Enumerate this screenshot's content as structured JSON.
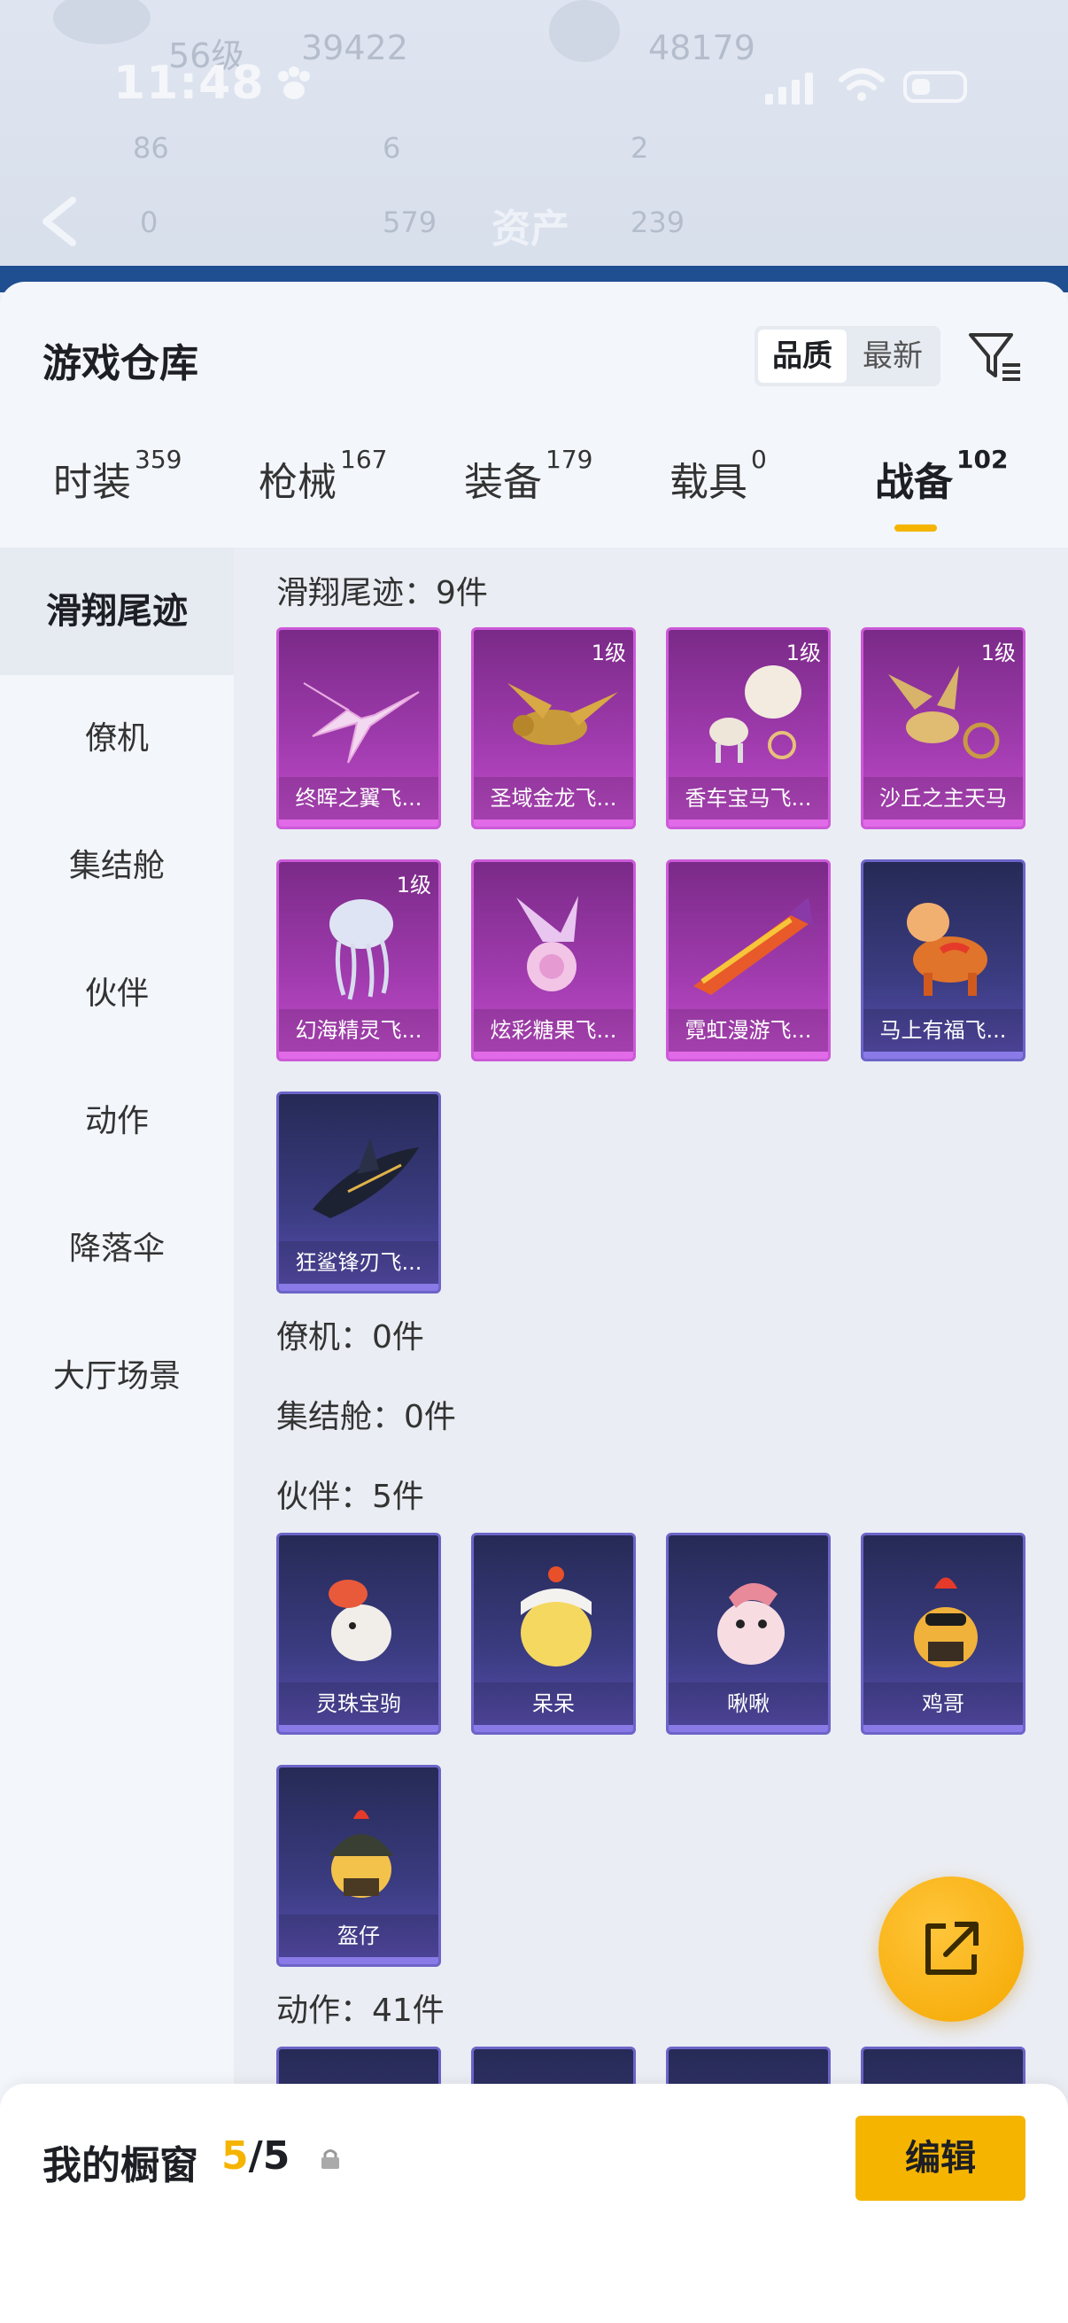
{
  "status_bar": {
    "time": "11:48"
  },
  "background": {
    "rows": [
      "56级",
      "39422",
      "48179",
      "86",
      "6",
      "2",
      "0",
      "579",
      "239"
    ],
    "title": "资产"
  },
  "header": {
    "title": "游戏仓库",
    "sort": [
      "品质",
      "最新"
    ]
  },
  "tabs": [
    {
      "label": "时装",
      "count": "359"
    },
    {
      "label": "枪械",
      "count": "167"
    },
    {
      "label": "装备",
      "count": "179"
    },
    {
      "label": "载具",
      "count": "0"
    },
    {
      "label": "战备",
      "count": "102"
    }
  ],
  "sidebar": [
    "滑翔尾迹",
    "僚机",
    "集结舱",
    "伙伴",
    "动作",
    "降落伞",
    "大厅场景"
  ],
  "sections": {
    "glide": {
      "title": "滑翔尾迹：9件",
      "items": [
        {
          "name": "终晖之翼飞...",
          "level": ""
        },
        {
          "name": "圣域金龙飞...",
          "level": "1级"
        },
        {
          "name": "香车宝马飞...",
          "level": "1级"
        },
        {
          "name": "沙丘之主天马",
          "level": "1级"
        },
        {
          "name": "幻海精灵飞...",
          "level": "1级"
        },
        {
          "name": "炫彩糖果飞...",
          "level": ""
        },
        {
          "name": "霓虹漫游飞...",
          "level": ""
        },
        {
          "name": "马上有福飞...",
          "level": ""
        },
        {
          "name": "狂鲨锋刃飞...",
          "level": ""
        }
      ]
    },
    "wingman": {
      "title": "僚机：0件"
    },
    "pod": {
      "title": "集结舱：0件"
    },
    "partner": {
      "title": "伙伴：5件",
      "items": [
        {
          "name": "灵珠宝驹"
        },
        {
          "name": "呆呆"
        },
        {
          "name": "啾啾"
        },
        {
          "name": "鸡哥"
        },
        {
          "name": "盔仔"
        }
      ]
    },
    "action": {
      "title": "动作：41件"
    }
  },
  "bottom": {
    "label": "我的橱窗",
    "count_current": "5",
    "count_total": "/5",
    "edit": "编辑"
  },
  "colors": {
    "accent": "#f5b400",
    "card_pink": "#a23cb0",
    "card_blue": "#3b3c82"
  }
}
